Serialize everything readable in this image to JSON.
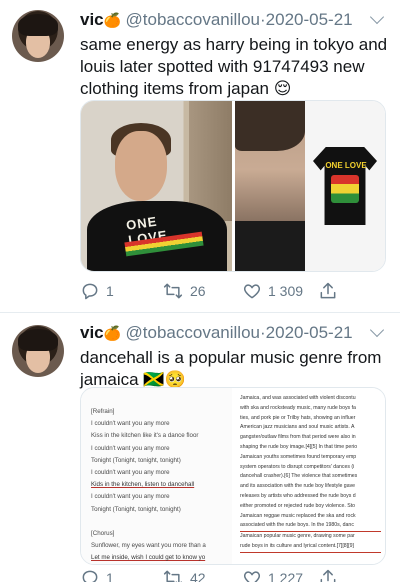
{
  "tweets": [
    {
      "display_name": "vic",
      "name_emoji": "🍊",
      "handle": "@tobaccovanillou",
      "date": "2020-05-21",
      "text": "same energy as harry being in tokyo and louis later spotted with 91747493 new clothing items from japan 😌",
      "media": {
        "left_shirt_text": "ONE LOVE",
        "right_shirt_text": "ONE LOVE"
      },
      "stats": {
        "replies": "1",
        "retweets": "26",
        "likes": "1 309"
      }
    },
    {
      "display_name": "vic",
      "name_emoji": "🍊",
      "handle": "@tobaccovanillou",
      "date": "2020-05-21",
      "text": "dancehall is a popular music genre from jamaica 🇯🇲🥺",
      "media": {
        "lyrics": [
          "[Refrain]",
          "I couldn't want you any more",
          "Kiss in the kitchen like it's a dance floor",
          "I couldn't want you any more",
          "Tonight (Tonight, tonight, tonight)",
          "I couldn't want you any more",
          "Kids in the kitchen, listen to dancehall",
          "I couldn't want you any more",
          "Tonight (Tonight, tonight, tonight)",
          "",
          "[Chorus]",
          "Sunflower, my eyes want you more than a",
          "Let me inside, wish I could get to know yo"
        ],
        "wiki": [
          "Jamaica, and was associated with violent discontu",
          "with ska and rocksteady music, many rude boys fa",
          "ties, and pork pie or Trilby hats, showing an influer",
          "American jazz musicians and soul music artists. A",
          "gangster/outlaw films from that period were also in",
          "shaping the rude boy image.[4][5] In that time perio",
          "Jamaican youths sometimes found temporary emp",
          "system operators to disrupt competitors' dances (i",
          "dancehall crasher).[6] The violence that sometimes",
          "and its association with the rude boy lifestyle gave",
          "releases by artists who addressed the rude boys d",
          "either promoted or rejected rude boy violence. Sto",
          "Jamaican reggae music replaced the ska and rock",
          "associated with the rude boys. In the 1980s, danc",
          "Jamaican popular music genre, drawing some par",
          "rude boys in its culture and lyrical content.[7][8][9]"
        ]
      },
      "stats": {
        "replies": "1",
        "retweets": "42",
        "likes": "1 227"
      }
    }
  ],
  "icons": {
    "reply": "reply-icon",
    "retweet": "retweet-icon",
    "like": "heart-icon",
    "share": "share-icon",
    "menu": "chevron-down-icon"
  },
  "colors": {
    "text": "#14171a",
    "muted": "#657786",
    "divider": "#e6ecf0",
    "link": "#3366cc"
  }
}
